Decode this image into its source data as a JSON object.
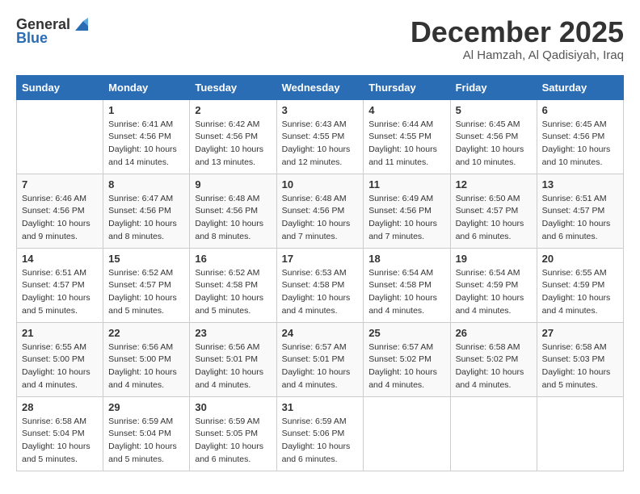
{
  "logo": {
    "general": "General",
    "blue": "Blue"
  },
  "title": "December 2025",
  "subtitle": "Al Hamzah, Al Qadisiyah, Iraq",
  "days_of_week": [
    "Sunday",
    "Monday",
    "Tuesday",
    "Wednesday",
    "Thursday",
    "Friday",
    "Saturday"
  ],
  "weeks": [
    [
      {
        "day": "",
        "info": ""
      },
      {
        "day": "1",
        "info": "Sunrise: 6:41 AM\nSunset: 4:56 PM\nDaylight: 10 hours\nand 14 minutes."
      },
      {
        "day": "2",
        "info": "Sunrise: 6:42 AM\nSunset: 4:56 PM\nDaylight: 10 hours\nand 13 minutes."
      },
      {
        "day": "3",
        "info": "Sunrise: 6:43 AM\nSunset: 4:55 PM\nDaylight: 10 hours\nand 12 minutes."
      },
      {
        "day": "4",
        "info": "Sunrise: 6:44 AM\nSunset: 4:55 PM\nDaylight: 10 hours\nand 11 minutes."
      },
      {
        "day": "5",
        "info": "Sunrise: 6:45 AM\nSunset: 4:56 PM\nDaylight: 10 hours\nand 10 minutes."
      },
      {
        "day": "6",
        "info": "Sunrise: 6:45 AM\nSunset: 4:56 PM\nDaylight: 10 hours\nand 10 minutes."
      }
    ],
    [
      {
        "day": "7",
        "info": "Sunrise: 6:46 AM\nSunset: 4:56 PM\nDaylight: 10 hours\nand 9 minutes."
      },
      {
        "day": "8",
        "info": "Sunrise: 6:47 AM\nSunset: 4:56 PM\nDaylight: 10 hours\nand 8 minutes."
      },
      {
        "day": "9",
        "info": "Sunrise: 6:48 AM\nSunset: 4:56 PM\nDaylight: 10 hours\nand 8 minutes."
      },
      {
        "day": "10",
        "info": "Sunrise: 6:48 AM\nSunset: 4:56 PM\nDaylight: 10 hours\nand 7 minutes."
      },
      {
        "day": "11",
        "info": "Sunrise: 6:49 AM\nSunset: 4:56 PM\nDaylight: 10 hours\nand 7 minutes."
      },
      {
        "day": "12",
        "info": "Sunrise: 6:50 AM\nSunset: 4:57 PM\nDaylight: 10 hours\nand 6 minutes."
      },
      {
        "day": "13",
        "info": "Sunrise: 6:51 AM\nSunset: 4:57 PM\nDaylight: 10 hours\nand 6 minutes."
      }
    ],
    [
      {
        "day": "14",
        "info": "Sunrise: 6:51 AM\nSunset: 4:57 PM\nDaylight: 10 hours\nand 5 minutes."
      },
      {
        "day": "15",
        "info": "Sunrise: 6:52 AM\nSunset: 4:57 PM\nDaylight: 10 hours\nand 5 minutes."
      },
      {
        "day": "16",
        "info": "Sunrise: 6:52 AM\nSunset: 4:58 PM\nDaylight: 10 hours\nand 5 minutes."
      },
      {
        "day": "17",
        "info": "Sunrise: 6:53 AM\nSunset: 4:58 PM\nDaylight: 10 hours\nand 4 minutes."
      },
      {
        "day": "18",
        "info": "Sunrise: 6:54 AM\nSunset: 4:58 PM\nDaylight: 10 hours\nand 4 minutes."
      },
      {
        "day": "19",
        "info": "Sunrise: 6:54 AM\nSunset: 4:59 PM\nDaylight: 10 hours\nand 4 minutes."
      },
      {
        "day": "20",
        "info": "Sunrise: 6:55 AM\nSunset: 4:59 PM\nDaylight: 10 hours\nand 4 minutes."
      }
    ],
    [
      {
        "day": "21",
        "info": "Sunrise: 6:55 AM\nSunset: 5:00 PM\nDaylight: 10 hours\nand 4 minutes."
      },
      {
        "day": "22",
        "info": "Sunrise: 6:56 AM\nSunset: 5:00 PM\nDaylight: 10 hours\nand 4 minutes."
      },
      {
        "day": "23",
        "info": "Sunrise: 6:56 AM\nSunset: 5:01 PM\nDaylight: 10 hours\nand 4 minutes."
      },
      {
        "day": "24",
        "info": "Sunrise: 6:57 AM\nSunset: 5:01 PM\nDaylight: 10 hours\nand 4 minutes."
      },
      {
        "day": "25",
        "info": "Sunrise: 6:57 AM\nSunset: 5:02 PM\nDaylight: 10 hours\nand 4 minutes."
      },
      {
        "day": "26",
        "info": "Sunrise: 6:58 AM\nSunset: 5:02 PM\nDaylight: 10 hours\nand 4 minutes."
      },
      {
        "day": "27",
        "info": "Sunrise: 6:58 AM\nSunset: 5:03 PM\nDaylight: 10 hours\nand 5 minutes."
      }
    ],
    [
      {
        "day": "28",
        "info": "Sunrise: 6:58 AM\nSunset: 5:04 PM\nDaylight: 10 hours\nand 5 minutes."
      },
      {
        "day": "29",
        "info": "Sunrise: 6:59 AM\nSunset: 5:04 PM\nDaylight: 10 hours\nand 5 minutes."
      },
      {
        "day": "30",
        "info": "Sunrise: 6:59 AM\nSunset: 5:05 PM\nDaylight: 10 hours\nand 6 minutes."
      },
      {
        "day": "31",
        "info": "Sunrise: 6:59 AM\nSunset: 5:06 PM\nDaylight: 10 hours\nand 6 minutes."
      },
      {
        "day": "",
        "info": ""
      },
      {
        "day": "",
        "info": ""
      },
      {
        "day": "",
        "info": ""
      }
    ]
  ]
}
